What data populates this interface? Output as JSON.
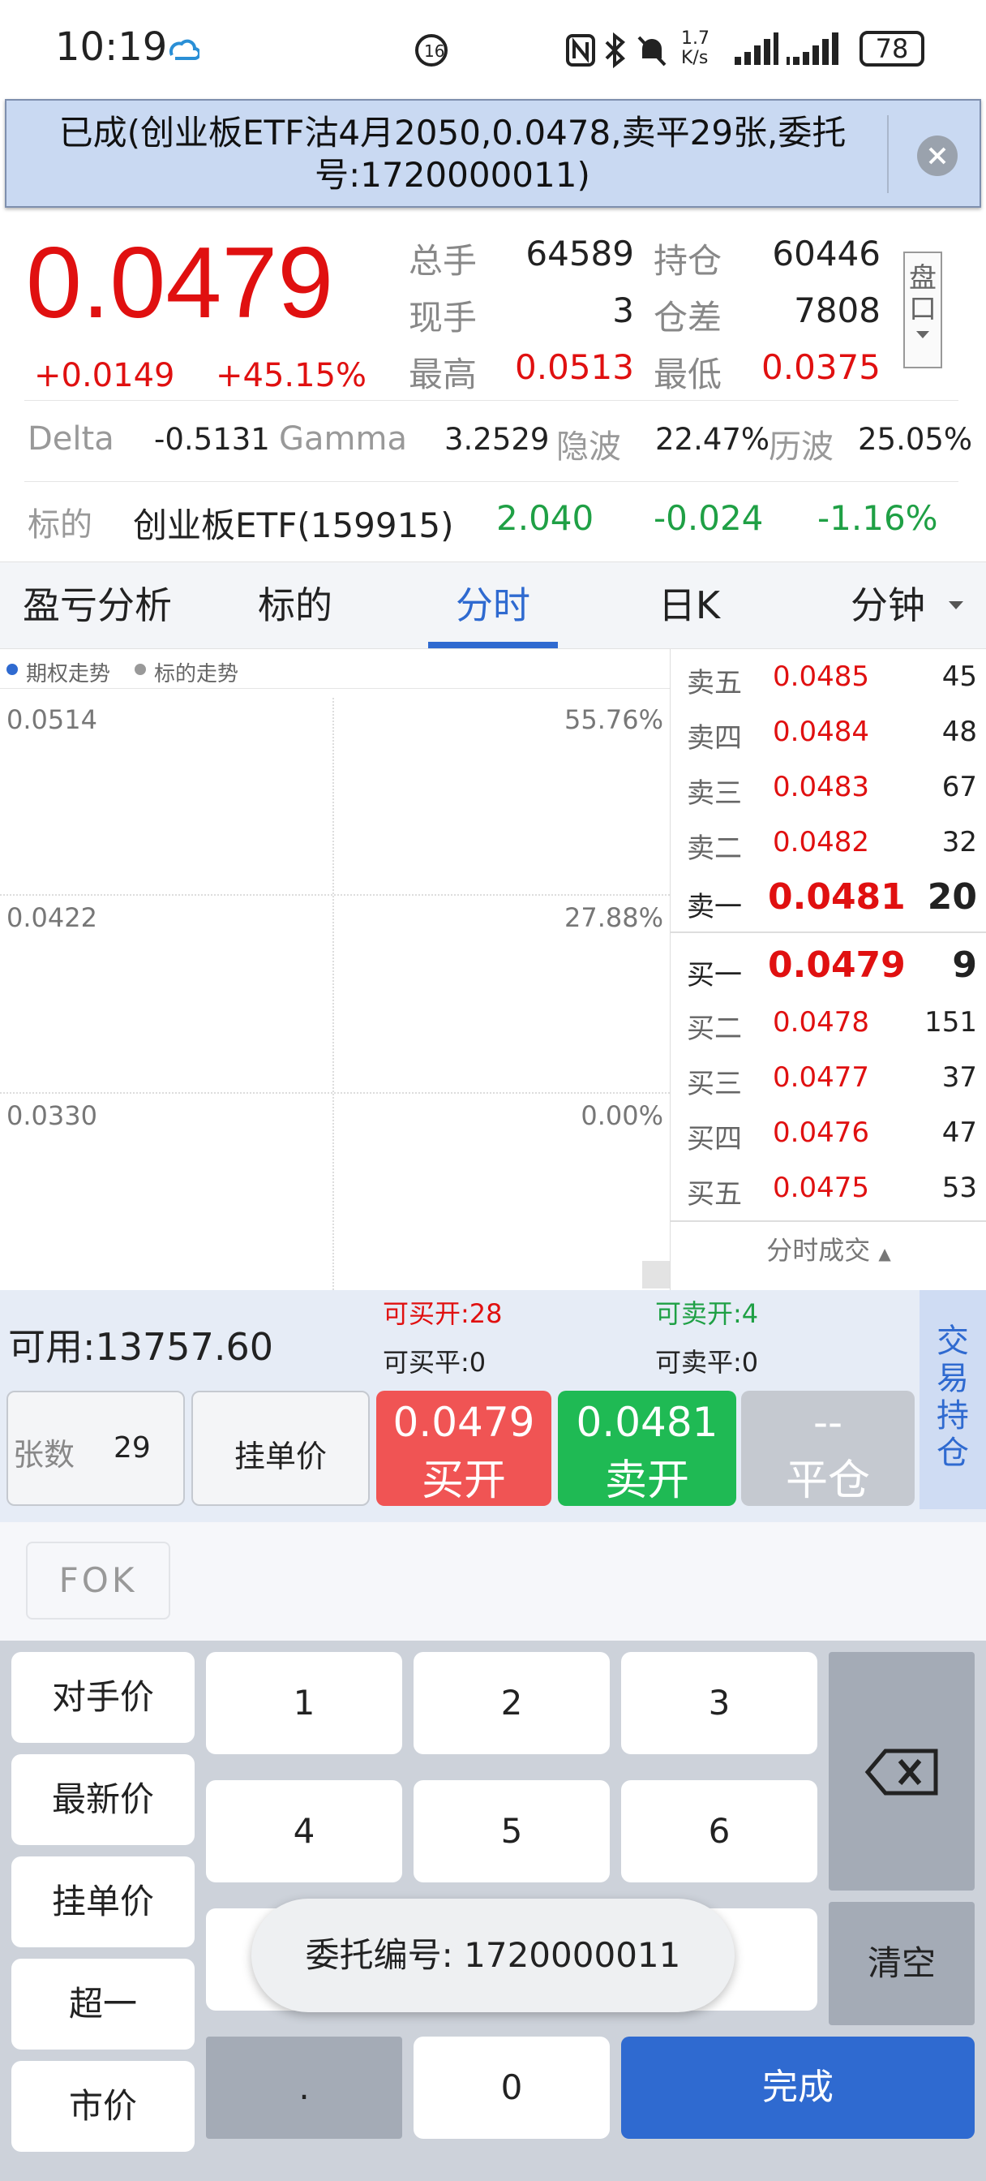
{
  "status": {
    "time": "10:19",
    "speed_top": "1.7",
    "speed_bottom": "K/s",
    "battery": "78"
  },
  "banner": {
    "line1": "已成(创业板ETF沽4月2050,0.0478,卖平29张,委托",
    "line2": "号:1720000011)"
  },
  "quote": {
    "price": "0.0479",
    "change": "+0.0149",
    "change_pct": "+45.15%",
    "stats": [
      {
        "label": "总手",
        "value": "64589",
        "label2": "持仓",
        "value2": "60446"
      },
      {
        "label": "现手",
        "value": "3",
        "label2": "仓差",
        "value2": "7808"
      },
      {
        "label": "最高",
        "value": "0.0513",
        "label2": "最低",
        "value2": "0.0375"
      }
    ],
    "pankou": "盘口",
    "greeks": {
      "delta_label": "Delta",
      "delta": "-0.5131",
      "gamma_label": "Gamma",
      "gamma": "3.2529",
      "iv_label": "隐波",
      "iv": "22.47%",
      "hv_label": "历波",
      "hv": "25.05%"
    },
    "underlying": {
      "label": "标的",
      "name": "创业板ETF(159915)",
      "price": "2.040",
      "change": "-0.024",
      "change_pct": "-1.16%"
    }
  },
  "tabs": [
    "盈亏分析",
    "标的",
    "分时",
    "日K",
    "分钟"
  ],
  "chart": {
    "legend1": "期权走势",
    "legend2": "标的走势",
    "y": [
      {
        "left": "0.0514",
        "right": "55.76%"
      },
      {
        "left": "0.0422",
        "right": "27.88%"
      },
      {
        "left": "0.0330",
        "right": "0.00%"
      }
    ]
  },
  "book": {
    "asks": [
      {
        "label": "卖五",
        "price": "0.0485",
        "qty": "45"
      },
      {
        "label": "卖四",
        "price": "0.0484",
        "qty": "48"
      },
      {
        "label": "卖三",
        "price": "0.0483",
        "qty": "67"
      },
      {
        "label": "卖二",
        "price": "0.0482",
        "qty": "32"
      },
      {
        "label": "卖一",
        "price": "0.0481",
        "qty": "20"
      }
    ],
    "bids": [
      {
        "label": "买一",
        "price": "0.0479",
        "qty": "9"
      },
      {
        "label": "买二",
        "price": "0.0478",
        "qty": "151"
      },
      {
        "label": "买三",
        "price": "0.0477",
        "qty": "37"
      },
      {
        "label": "买四",
        "price": "0.0476",
        "qty": "47"
      },
      {
        "label": "买五",
        "price": "0.0475",
        "qty": "53"
      }
    ],
    "footer": "分时成交"
  },
  "trade": {
    "available": "可用:13757.60",
    "can_buy_open": "可买开:28",
    "can_buy_close": "可买平:0",
    "can_sell_open": "可卖开:4",
    "can_sell_close": "可卖平:0",
    "side_tab": [
      "交",
      "易",
      "持",
      "仓"
    ],
    "qty_label": "张数",
    "qty_value": "29",
    "order_price": "挂单价",
    "buy_price": "0.0479",
    "buy_label": "买开",
    "sell_price": "0.0481",
    "sell_label": "卖开",
    "close_price": "--",
    "close_label": "平仓",
    "fok": "FOK"
  },
  "keyboard": {
    "left": [
      "对手价",
      "最新价",
      "挂单价",
      "超一",
      "市价"
    ],
    "digits": [
      "1",
      "2",
      "3",
      "4",
      "5",
      "6",
      "0",
      "."
    ],
    "clear": "清空",
    "done": "完成"
  },
  "toast": "委托编号:  1720000011",
  "colors": {
    "red": "#e01010",
    "green": "#1fa045",
    "blue": "#2f6ad0"
  }
}
